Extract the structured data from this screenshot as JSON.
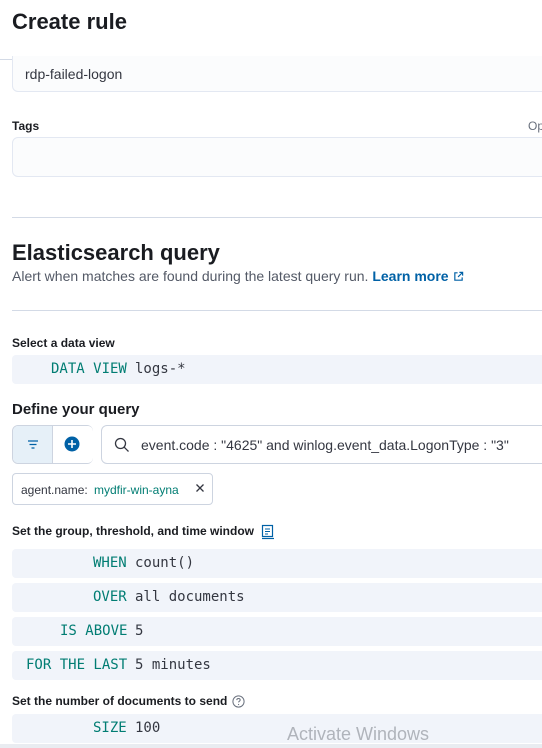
{
  "header": {
    "title": "Create rule"
  },
  "name_field": {
    "value": "rdp-failed-logon"
  },
  "tags": {
    "label": "Tags",
    "optional": "Op"
  },
  "query_section": {
    "title": "Elasticsearch query",
    "description": "Alert when matches are found during the latest query run.",
    "learn_more": "Learn more"
  },
  "data_view": {
    "label": "Select a data view",
    "keyword": "DATA VIEW",
    "value": "logs-*"
  },
  "define_query": {
    "label": "Define your query",
    "query_text": "event.code : \"4625\" and winlog.event_data.LogonType : \"3\"",
    "filter_pill": {
      "key": "agent.name:",
      "value": "mydfir-win-ayna"
    }
  },
  "threshold": {
    "label": "Set the group, threshold, and time window",
    "rows": [
      {
        "keyword": "WHEN",
        "value": "count()"
      },
      {
        "keyword": "OVER",
        "value": "all documents"
      },
      {
        "keyword": "IS ABOVE",
        "value": "5"
      },
      {
        "keyword": "FOR THE LAST",
        "value": "5 minutes"
      }
    ]
  },
  "size": {
    "label": "Set the number of documents to send",
    "keyword": "SIZE",
    "value": "100"
  },
  "watermark": "Activate Windows",
  "colors": {
    "accent": "#0061a6",
    "keyword": "#017d73",
    "expr_bg": "#f1f4fa"
  }
}
